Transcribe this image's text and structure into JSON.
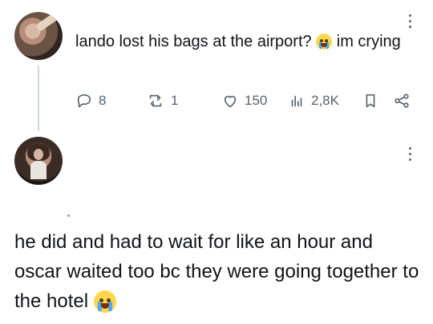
{
  "thread": {
    "tweet1": {
      "text_before_emoji": "lando lost his bags at the airport? ",
      "emoji_name": "crying-face",
      "text_after_emoji": " im crying",
      "stats": {
        "replies": "8",
        "retweets": "1",
        "likes": "150",
        "views": "2,8K"
      }
    },
    "tweet2": {
      "text": "he did and had to wait for like an hour and oscar waited too bc they were going together to the hotel ",
      "emoji_name": "crying-face"
    }
  },
  "icons": {
    "reply": "reply-icon",
    "retweet": "retweet-icon",
    "like": "heart-icon",
    "views": "views-icon",
    "bookmark": "bookmark-icon",
    "share": "share-icon",
    "more": "more-icon"
  },
  "colors": {
    "text": "#0f1419",
    "secondary": "#536471",
    "thread_line": "#cfd9de",
    "emoji": "#ffd64d"
  }
}
